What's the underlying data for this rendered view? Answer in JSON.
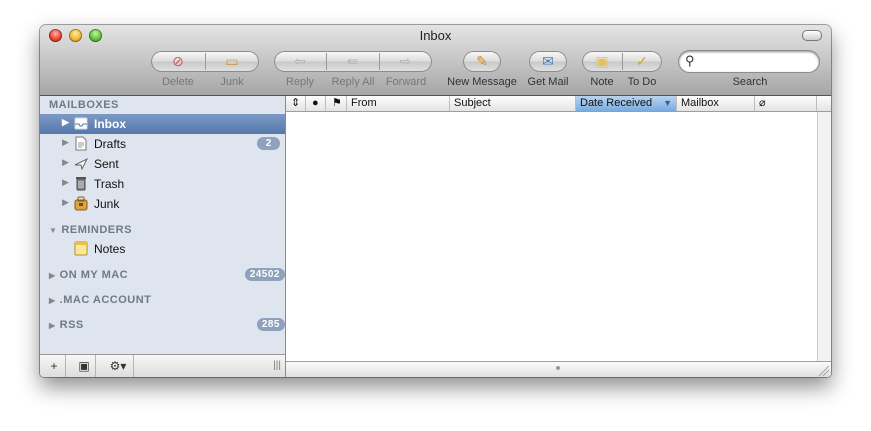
{
  "window": {
    "title": "Inbox"
  },
  "toolbar": {
    "delete": "Delete",
    "junk": "Junk",
    "reply": "Reply",
    "reply_all": "Reply All",
    "forward": "Forward",
    "new_message": "New Message",
    "get_mail": "Get Mail",
    "note": "Note",
    "todo": "To Do",
    "search_label": "Search",
    "search_value": ""
  },
  "sidebar": {
    "mailboxes_header": "MAILBOXES",
    "items": [
      {
        "label": "Inbox",
        "icon": "inbox-icon",
        "selected": true
      },
      {
        "label": "Drafts",
        "icon": "drafts-icon",
        "badge": "2"
      },
      {
        "label": "Sent",
        "icon": "sent-icon"
      },
      {
        "label": "Trash",
        "icon": "trash-icon"
      },
      {
        "label": "Junk",
        "icon": "junk-icon"
      }
    ],
    "reminders_header": "REMINDERS",
    "notes_label": "Notes",
    "groups": [
      {
        "label": "ON MY MAC",
        "badge": "24502"
      },
      {
        "label": ".MAC ACCOUNT"
      },
      {
        "label": "RSS",
        "badge": "285"
      }
    ]
  },
  "message_list": {
    "columns": [
      "From",
      "Subject",
      "Date Received",
      "Mailbox"
    ],
    "sort_column": "Date Received"
  },
  "colors": {
    "selection": "#5577aa",
    "sidebar_bg": "#dfe5ee",
    "sorted_header": "#7aaae0",
    "badge": "#8ea1bd"
  }
}
